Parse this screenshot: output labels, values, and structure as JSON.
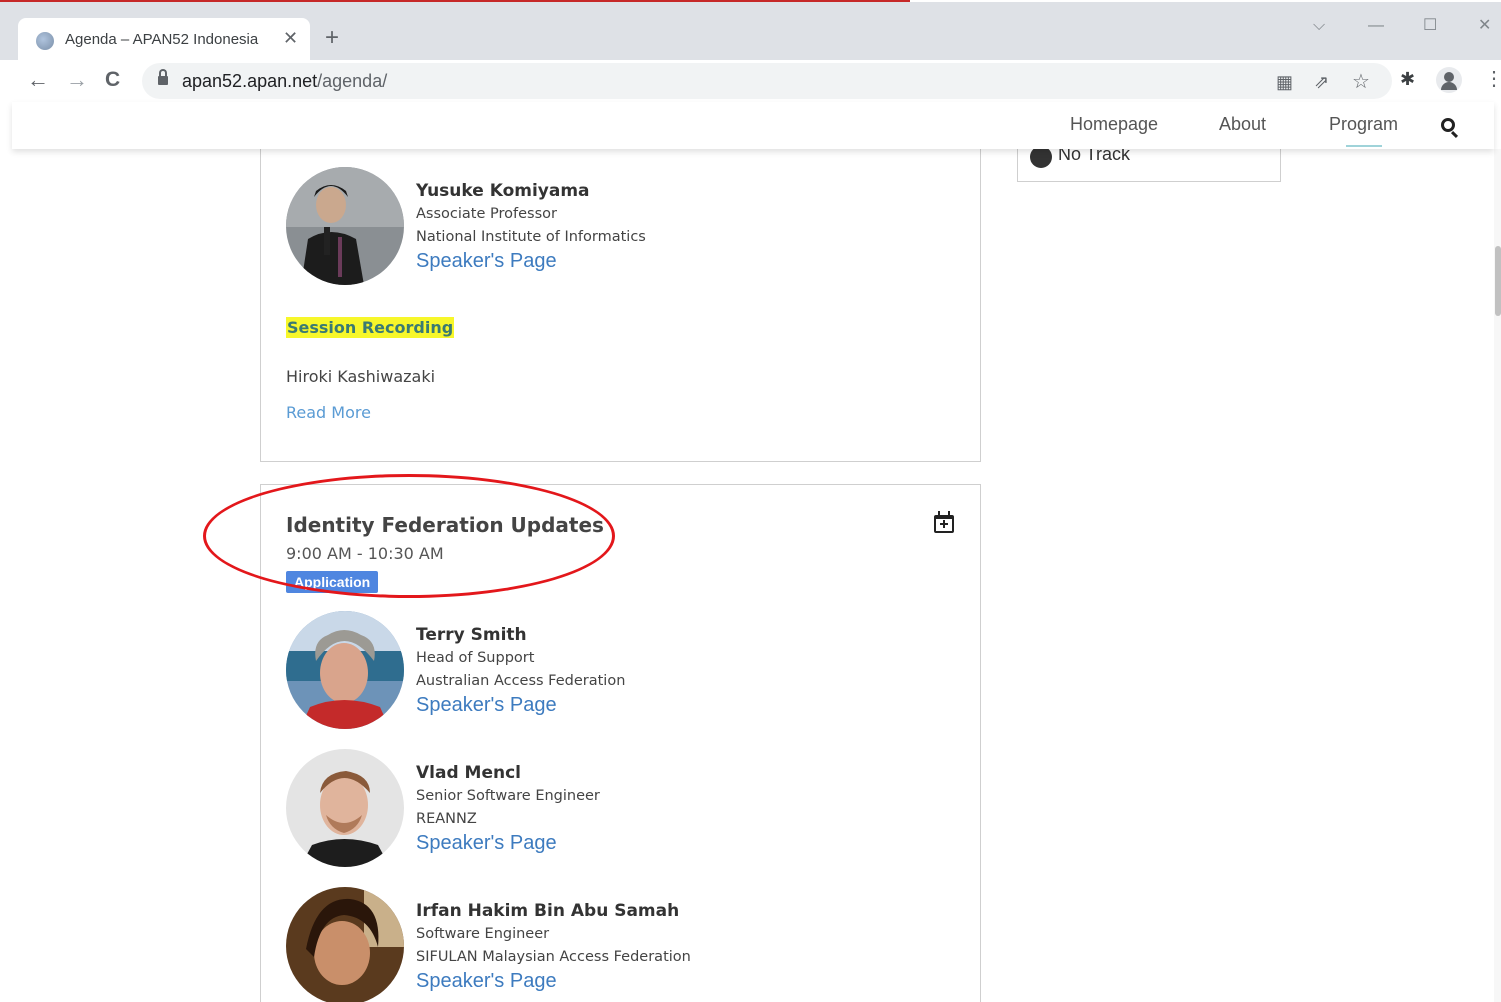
{
  "browser": {
    "tab": {
      "title": "Agenda – APAN52 Indonesia",
      "close": "✕"
    },
    "new_tab": "+",
    "window_controls": {
      "dropdown": "⌵",
      "minimize": "—",
      "maximize": "☐",
      "close": "✕"
    },
    "nav": {
      "back": "←",
      "forward": "→",
      "reload": "C"
    },
    "address": {
      "host": "apan52.apan.net",
      "path": "/agenda/"
    },
    "toolbar_icons": [
      "translate-icon",
      "share-icon",
      "star-icon",
      "extensions-icon",
      "profile-icon",
      "menu-icon"
    ],
    "icon_glyphs": {
      "translate": "▦",
      "share": "⇗",
      "star": "☆",
      "extensions": "✱",
      "menu": "⋮"
    }
  },
  "site": {
    "nav": [
      "Homepage",
      "About",
      "Program"
    ],
    "active_nav": "Program"
  },
  "legend": {
    "label": "No Track",
    "dot_color": "#333333"
  },
  "session1": {
    "speaker": {
      "name": "Yusuke Komiyama",
      "title": "Associate Professor",
      "org": "National Institute of Informatics",
      "link": "Speaker's Page"
    },
    "recording": "Session Recording",
    "chair": "Hiroki Kashiwazaki",
    "read_more": "Read More"
  },
  "session2": {
    "title": "Identity Federation Updates",
    "time": "9:00 AM - 10:30 AM",
    "badge": "Application",
    "badge_color": "#4f86e0",
    "speakers": [
      {
        "name": "Terry Smith",
        "title": "Head of Support",
        "org": "Australian Access Federation",
        "link": "Speaker's Page"
      },
      {
        "name": "Vlad Mencl",
        "title": "Senior Software Engineer",
        "org": "REANNZ",
        "link": "Speaker's Page"
      },
      {
        "name": "Irfan Hakim Bin Abu Samah",
        "title": "Software Engineer",
        "org": "SIFULAN Malaysian Access Federation",
        "link": "Speaker's Page"
      }
    ]
  },
  "annotation_color": "#e3171b"
}
